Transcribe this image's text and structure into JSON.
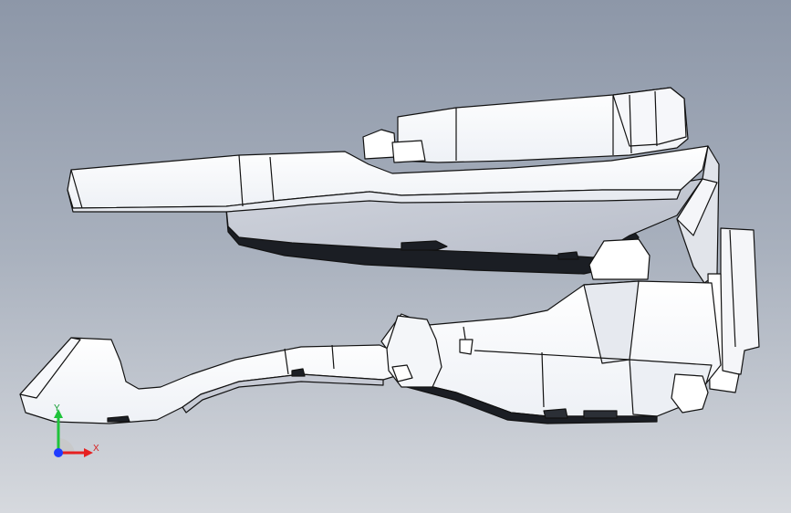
{
  "viewport": {
    "background_top": "#8d97a8",
    "background_bottom": "#d6d9de"
  },
  "model": {
    "face_color": "#ffffff",
    "shade_color": "#d7dbe4",
    "dark_color": "#1b1e24",
    "edge_color": "#121212"
  },
  "triad": {
    "y_label": "Y",
    "x_label": "X",
    "y_color": "#1fc33b",
    "x_color": "#e62020",
    "z_color": "#1f3cff"
  }
}
